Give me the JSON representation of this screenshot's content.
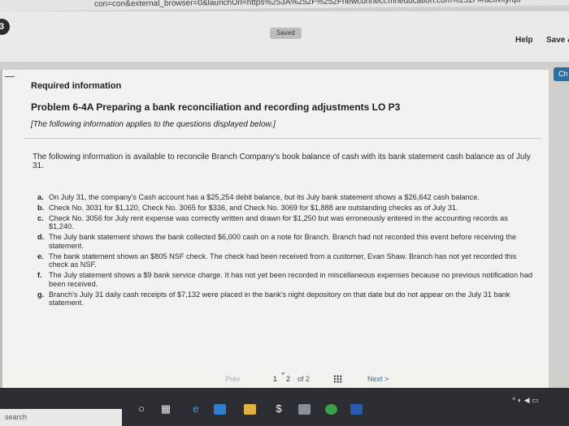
{
  "browser": {
    "url": "con=con&external_browser=0&launchUrl=https%253A%252F%252Fnewconnect.mheducation.com%252F#/activity/qu"
  },
  "header": {
    "step_badge": "3",
    "saved_label": "Saved",
    "help_label": "Help",
    "save_exit_label": "Save &",
    "check_label": "Ch"
  },
  "content": {
    "required_info": "Required information",
    "problem_title": "Problem 6-4A Preparing a bank reconciliation and recording adjustments LO P3",
    "problem_note": "[The following information applies to the questions displayed below.]",
    "intro": "The following information is available to reconcile Branch Company's book balance of cash with its bank statement cash balance as of July 31.",
    "items": [
      {
        "letter": "a.",
        "text": "On July 31, the company's Cash account has a $25,254 debit balance, but its July bank statement shows a $26,642 cash balance."
      },
      {
        "letter": "b.",
        "text": "Check No. 3031 for $1,120, Check No. 3065 for $336, and Check No. 3069 for $1,888 are outstanding checks as of July 31."
      },
      {
        "letter": "c.",
        "text": "Check No. 3056 for July rent expense was correctly written and drawn for $1,250 but was erroneously entered in the accounting records as $1,240."
      },
      {
        "letter": "d.",
        "text": "The July bank statement shows the bank collected $6,000 cash on a note for Branch. Branch had not recorded this event before receiving the statement."
      },
      {
        "letter": "e.",
        "text": "The bank statement shows an $805 NSF check. The check had been received from a customer, Evan Shaw. Branch has not yet recorded this check as NSF."
      },
      {
        "letter": "f.",
        "text": "The July statement shows a $9 bank service charge. It has not yet been recorded in miscellaneous expenses because no previous notification had been received."
      },
      {
        "letter": "g.",
        "text": "Branch's July 31 daily cash receipts of $7,132 were placed in the bank's night depository on that date but do not appear on the July 31 bank statement."
      }
    ]
  },
  "pager": {
    "prev_label": "Prev",
    "page_one": "1",
    "page_two": "2",
    "of_label": "of 2",
    "next_label": "Next >"
  },
  "taskbar": {
    "search_label": "search",
    "icons": [
      "cortana-circle-icon",
      "task-view-icon",
      "edge-browser-icon",
      "file-explorer-icon",
      "store-icon",
      "dollar-app-icon",
      "mail-icon",
      "chrome-icon",
      "word-icon"
    ],
    "tray_label": "^ ◐ ◀ ▭"
  },
  "colors": {
    "accent": "#2a6fa1",
    "panel_bg": "#f2f2ef",
    "taskbar_bg": "#2b2d33"
  }
}
